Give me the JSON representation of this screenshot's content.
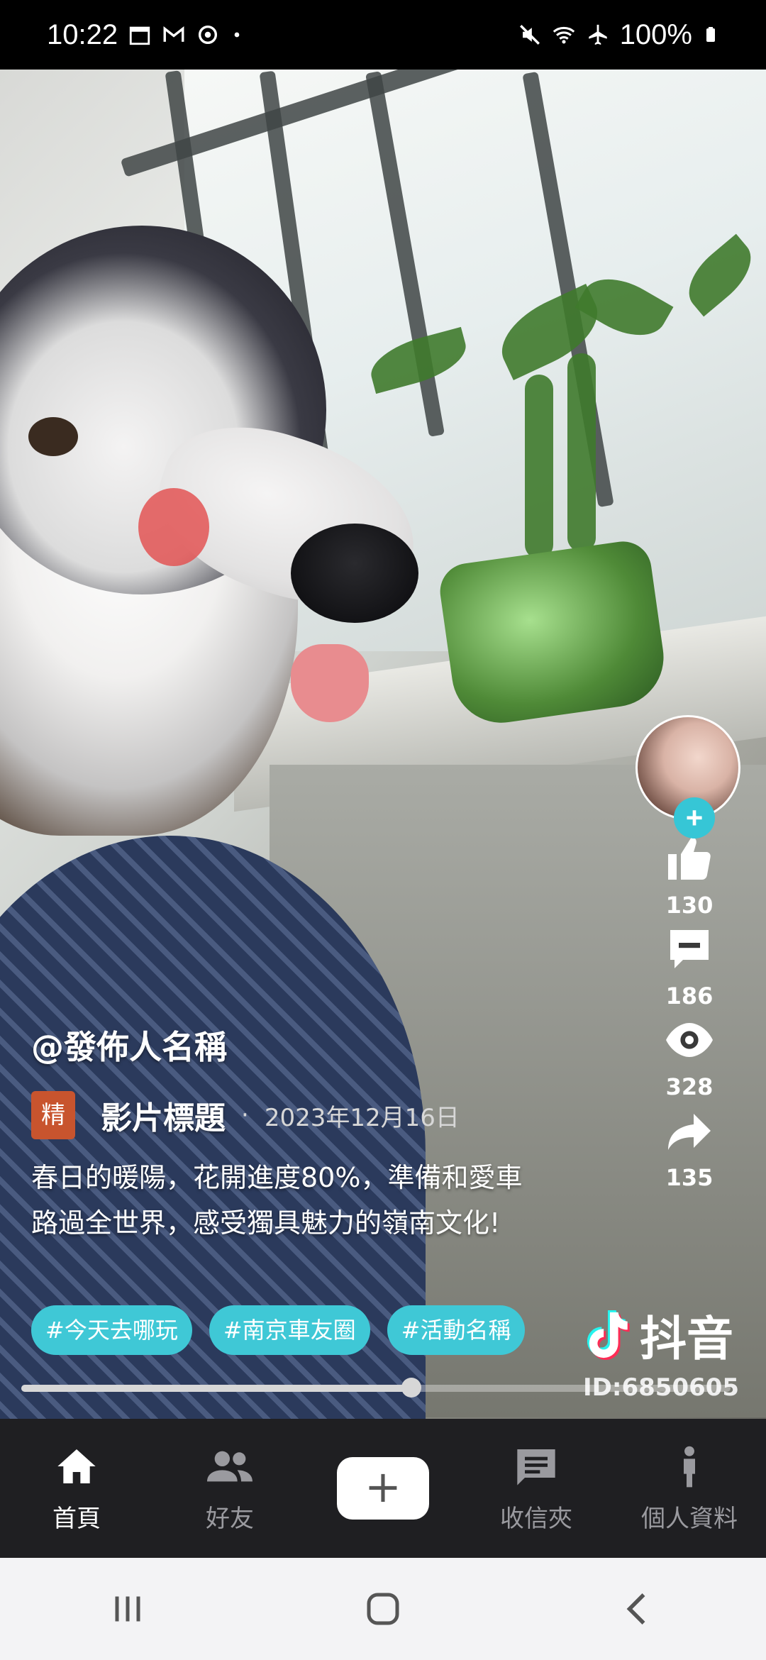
{
  "status_bar": {
    "time": "10:22",
    "battery": "100%",
    "icons": [
      "calendar-icon",
      "gmail-icon",
      "sync-icon",
      "dot-icon",
      "mute-icon",
      "wifi-icon",
      "airplane-icon",
      "battery-icon"
    ]
  },
  "video": {
    "author": "@發佈人名稱",
    "badge": "精",
    "title": "影片標題",
    "date": "2023年12月16日",
    "description": "春日的暖陽，花開進度80%，準備和愛車路過全世界，感受獨具魅力的嶺南文化!",
    "tags": [
      "#今天去哪玩",
      "#南京車友圈",
      "#活動名稱"
    ],
    "progress": 0.55
  },
  "actions": {
    "follow": "+",
    "likes": "130",
    "comments": "186",
    "views": "328",
    "shares": "135"
  },
  "watermark": {
    "brand": "抖音",
    "id": "ID:6850605"
  },
  "bottom_nav": {
    "home": "首頁",
    "friends": "好友",
    "add": "+",
    "inbox": "收信夾",
    "profile": "個人資料"
  },
  "colors": {
    "accent": "#3fc8d6",
    "badge": "#c8542e",
    "nav_bg": "#1f1f22"
  }
}
